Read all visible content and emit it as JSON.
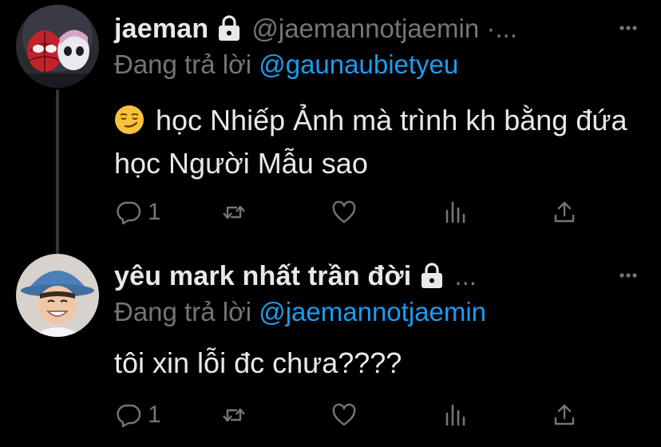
{
  "tweets": [
    {
      "display_name": "jaeman",
      "handle": "@jaemannotjaemin ·...",
      "replying_prefix": "Đang trả lời",
      "replying_to": "@gaunaubietyeu",
      "emoji": "smirking-face-emoji",
      "text": "học Nhiếp Ảnh mà trình kh bằng đứa học Người Mẫu sao",
      "reply_count": "1",
      "protected": true,
      "more_icon": "ellipsis-icon"
    },
    {
      "display_name": "yêu mark nhất trần đời",
      "handle": "...",
      "replying_prefix": "Đang trả lời",
      "replying_to": "@jaemannotjaemin",
      "text": "tôi xin lỗi đc chưa????",
      "reply_count": "1",
      "protected": true,
      "more_icon": "ellipsis-icon"
    }
  ],
  "colors": {
    "background": "#000000",
    "primary_text": "#e7e9ea",
    "secondary_text": "#71767b",
    "link": "#1d9bf0",
    "thread_line": "#333639"
  },
  "icons": [
    "reply-icon",
    "retweet-icon",
    "like-icon",
    "views-icon",
    "share-icon",
    "lock-icon",
    "ellipsis-icon"
  ]
}
